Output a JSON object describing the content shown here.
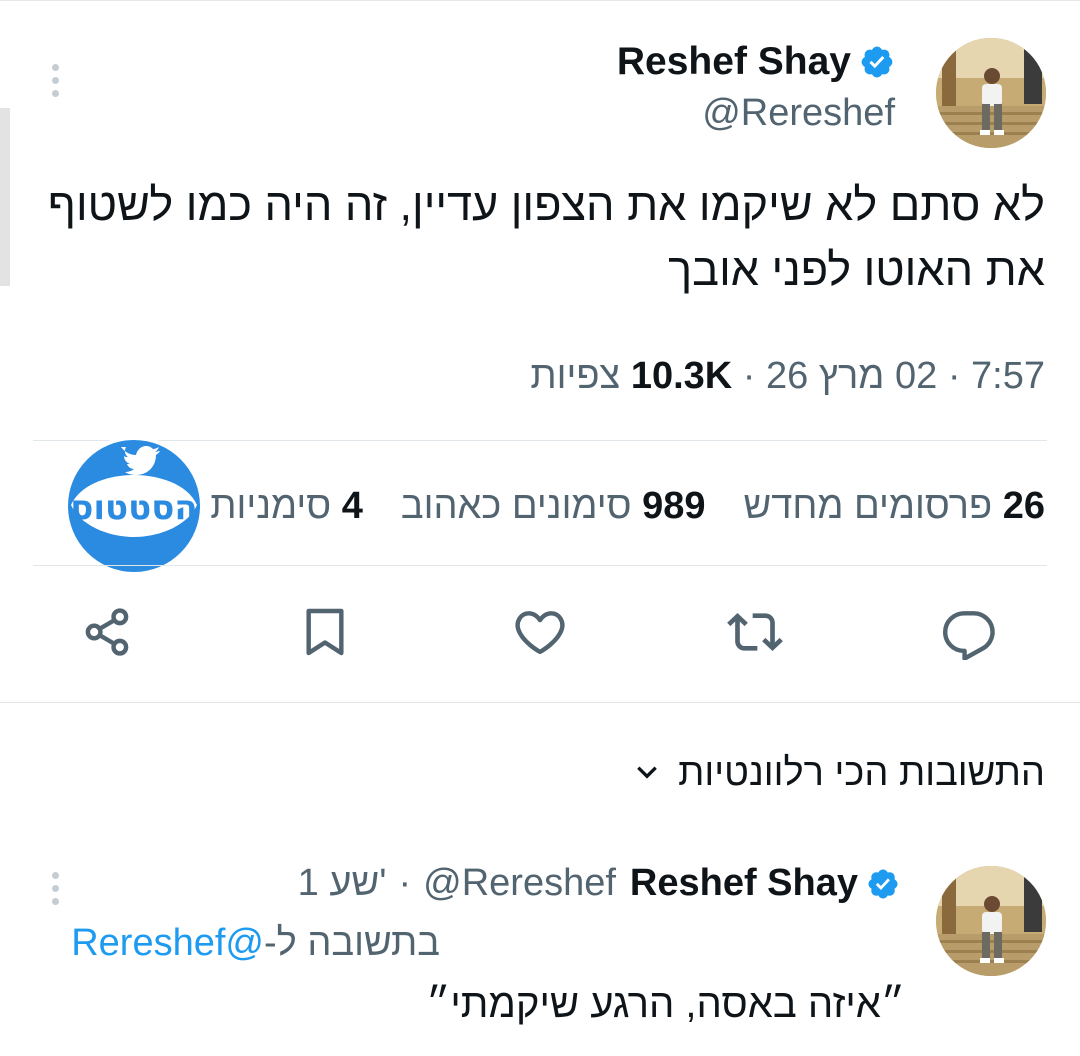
{
  "tweet": {
    "author_name": "Reshef Shay",
    "handle": "@Rereshef",
    "text": "לא סתם לא שיקמו את הצפון עדיין, זה היה כמו לשטוף את האוטו לפני אובך",
    "time": "7:57",
    "date": "02 מרץ 26",
    "separator": "·",
    "views_count": "10.3K",
    "views_label": "צפיות"
  },
  "stats": {
    "reposts_count": "26",
    "reposts_label": "פרסומים מחדש",
    "likes_count": "989",
    "likes_label": "סימונים כאהוב",
    "bookmarks_count": "4",
    "bookmarks_label": "סימניות"
  },
  "replies_sort": {
    "label": "התשובות הכי רלוונטיות"
  },
  "reply": {
    "author_name": "Reshef Shay",
    "handle": "@Rereshef",
    "separator": "·",
    "time_ago": "1 שע'",
    "replying_to_prefix": "בתשובה ל-",
    "replying_to_handle": "@Rereshef",
    "text": "״איזה באסה, הרגע שיקמתי״"
  },
  "watermark": {
    "text": "הסטטוס"
  },
  "colors": {
    "accent": "#1d9bf0",
    "secondary_text": "#536471",
    "primary_text": "#0f1419",
    "divider": "#e1e6ea",
    "watermark_blue": "#2a8be0"
  },
  "icons": {
    "verified": "verified-badge-icon",
    "more": "more-vertical-icon",
    "reply": "reply-icon",
    "repost": "repost-icon",
    "like": "heart-icon",
    "bookmark": "bookmark-icon",
    "share": "share-icon",
    "chevron": "chevron-down-icon"
  }
}
